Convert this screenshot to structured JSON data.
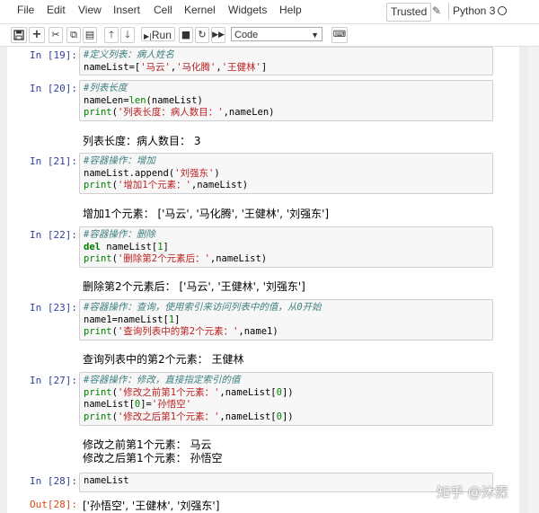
{
  "menu": {
    "items": [
      "File",
      "Edit",
      "View",
      "Insert",
      "Cell",
      "Kernel",
      "Widgets",
      "Help"
    ],
    "trusted": "Trusted",
    "kernel_name": "Python 3"
  },
  "toolbar": {
    "run_label": "Run",
    "cell_type": "Code",
    "icons": [
      "save-icon",
      "add-cell-icon",
      "cut-icon",
      "copy-icon",
      "paste-icon",
      "move-up-icon",
      "move-down-icon",
      "run-icon",
      "stop-icon",
      "restart-icon",
      "fast-forward-icon",
      "keyboard-icon"
    ]
  },
  "cells": [
    {
      "prompt": "In [19]:",
      "lines": [
        [
          {
            "t": "comment",
            "v": "#定义列表：病人姓名"
          }
        ],
        [
          {
            "t": "name",
            "v": "nameList=["
          },
          {
            "t": "str",
            "v": "'马云'"
          },
          {
            "t": "name",
            "v": ","
          },
          {
            "t": "str",
            "v": "'马化腾'"
          },
          {
            "t": "name",
            "v": ","
          },
          {
            "t": "str",
            "v": "'王健林'"
          },
          {
            "t": "name",
            "v": "]"
          }
        ]
      ],
      "output": []
    },
    {
      "prompt": "In [20]:",
      "lines": [
        [
          {
            "t": "comment",
            "v": "#列表长度"
          }
        ],
        [
          {
            "t": "name",
            "v": "nameLen="
          },
          {
            "t": "builtin",
            "v": "len"
          },
          {
            "t": "name",
            "v": "(nameList)"
          }
        ],
        [
          {
            "t": "builtin",
            "v": "print"
          },
          {
            "t": "name",
            "v": "("
          },
          {
            "t": "str",
            "v": "'列表长度：病人数目：'"
          },
          {
            "t": "name",
            "v": ",nameLen)"
          }
        ]
      ],
      "output": [
        "列表长度：病人数目： 3"
      ]
    },
    {
      "prompt": "In [21]:",
      "lines": [
        [
          {
            "t": "comment",
            "v": "#容器操作：增加"
          }
        ],
        [
          {
            "t": "name",
            "v": "nameList.append("
          },
          {
            "t": "str",
            "v": "'刘强东'"
          },
          {
            "t": "name",
            "v": ")"
          }
        ],
        [
          {
            "t": "builtin",
            "v": "print"
          },
          {
            "t": "name",
            "v": "("
          },
          {
            "t": "str",
            "v": "'增加1个元素：'"
          },
          {
            "t": "name",
            "v": ",nameList)"
          }
        ]
      ],
      "output": [
        "增加1个元素： ['马云', '马化腾', '王健林', '刘强东']"
      ]
    },
    {
      "prompt": "In [22]:",
      "lines": [
        [
          {
            "t": "comment",
            "v": "#容器操作：删除"
          }
        ],
        [
          {
            "t": "kw",
            "v": "del"
          },
          {
            "t": "name",
            "v": " nameList["
          },
          {
            "t": "num",
            "v": "1"
          },
          {
            "t": "name",
            "v": "]"
          }
        ],
        [
          {
            "t": "builtin",
            "v": "print"
          },
          {
            "t": "name",
            "v": "("
          },
          {
            "t": "str",
            "v": "'删除第2个元素后：'"
          },
          {
            "t": "name",
            "v": ",nameList)"
          }
        ]
      ],
      "output": [
        "删除第2个元素后： ['马云', '王健林', '刘强东']"
      ]
    },
    {
      "prompt": "In [23]:",
      "lines": [
        [
          {
            "t": "comment",
            "v": "#容器操作：查询，使用索引来访问列表中的值，从0开始"
          }
        ],
        [
          {
            "t": "name",
            "v": "name1=nameList["
          },
          {
            "t": "num",
            "v": "1"
          },
          {
            "t": "name",
            "v": "]"
          }
        ],
        [
          {
            "t": "builtin",
            "v": "print"
          },
          {
            "t": "name",
            "v": "("
          },
          {
            "t": "str",
            "v": "'查询列表中的第2个元素：'"
          },
          {
            "t": "name",
            "v": ",name1)"
          }
        ]
      ],
      "output": [
        "查询列表中的第2个元素： 王健林"
      ]
    },
    {
      "prompt": "In [27]:",
      "lines": [
        [
          {
            "t": "comment",
            "v": "#容器操作：修改，直接指定索引的值"
          }
        ],
        [
          {
            "t": "builtin",
            "v": "print"
          },
          {
            "t": "name",
            "v": "("
          },
          {
            "t": "str",
            "v": "'修改之前第1个元素：'"
          },
          {
            "t": "name",
            "v": ",nameList["
          },
          {
            "t": "num",
            "v": "0"
          },
          {
            "t": "name",
            "v": "])"
          }
        ],
        [
          {
            "t": "name",
            "v": "nameList["
          },
          {
            "t": "num",
            "v": "0"
          },
          {
            "t": "name",
            "v": "]="
          },
          {
            "t": "str",
            "v": "'孙悟空'"
          }
        ],
        [
          {
            "t": "builtin",
            "v": "print"
          },
          {
            "t": "name",
            "v": "("
          },
          {
            "t": "str",
            "v": "'修改之后第1个元素：'"
          },
          {
            "t": "name",
            "v": ",nameList["
          },
          {
            "t": "num",
            "v": "0"
          },
          {
            "t": "name",
            "v": "])"
          }
        ]
      ],
      "output": [
        "修改之前第1个元素： 马云",
        "修改之后第1个元素： 孙悟空"
      ]
    },
    {
      "prompt": "In [28]:",
      "lines": [
        [
          {
            "t": "name",
            "v": "nameList"
          }
        ]
      ],
      "out_prompt": "Out[28]:",
      "output": [
        "['孙悟空', '王健林', '刘强东']"
      ]
    }
  ],
  "watermark": "知乎 @沐霂"
}
